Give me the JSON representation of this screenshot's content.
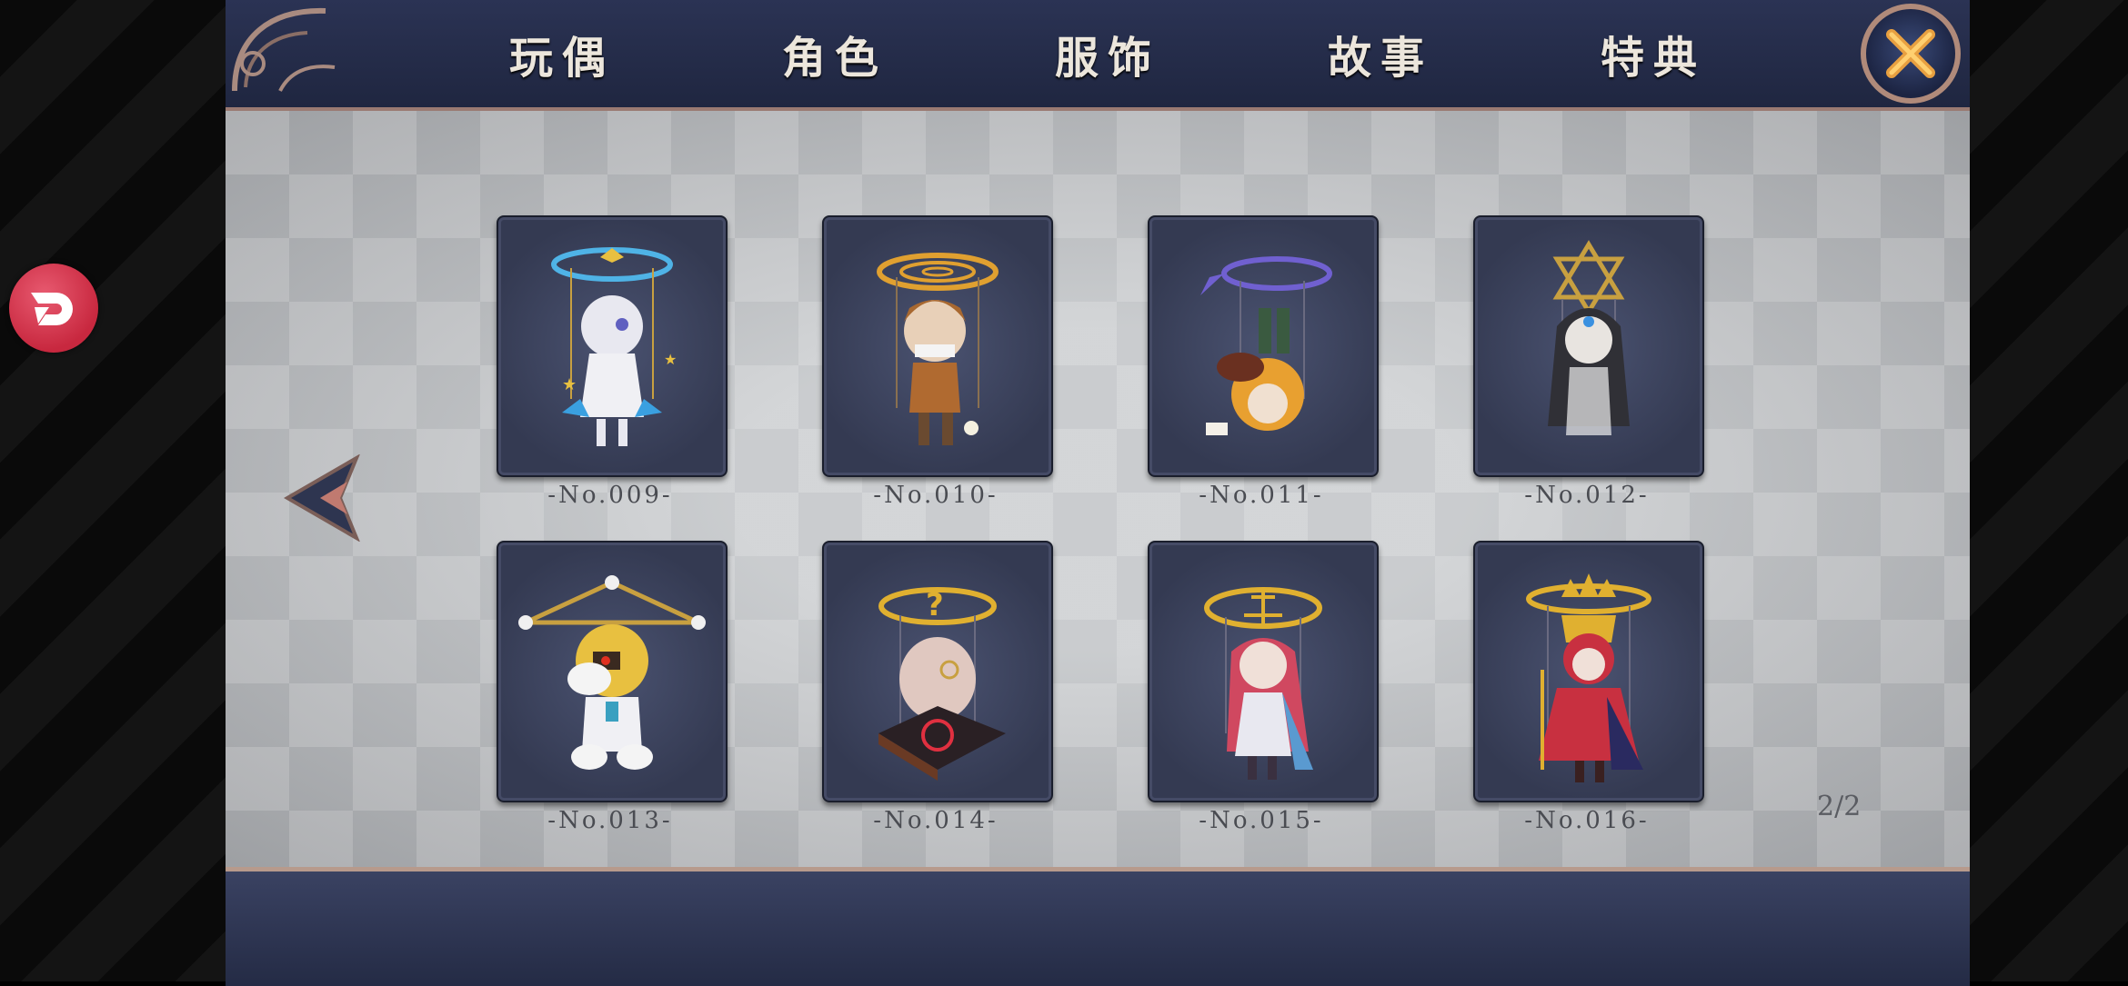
{
  "tabs": [
    {
      "label": "玩偶"
    },
    {
      "label": "角色"
    },
    {
      "label": "服饰"
    },
    {
      "label": "故事"
    },
    {
      "label": "特典"
    }
  ],
  "close_icon": "close-x-icon",
  "prev_icon": "chevron-left-icon",
  "float_icon": "overlay-logo-icon",
  "cards": [
    {
      "label": "-No.009-",
      "halo_color": "#4fb3e6",
      "figure_color": "#e8e8f0"
    },
    {
      "label": "-No.010-",
      "halo_color": "#e0a030",
      "figure_color": "#b06a30"
    },
    {
      "label": "-No.011-",
      "halo_color": "#7060d0",
      "figure_color": "#e8a030"
    },
    {
      "label": "-No.012-",
      "halo_color": "#c8a040",
      "figure_color": "#303036"
    },
    {
      "label": "-No.013-",
      "halo_color": "#c8a040",
      "figure_color": "#e8c040"
    },
    {
      "label": "-No.014-",
      "halo_color": "#e0b030",
      "figure_color": "#e0c8c0"
    },
    {
      "label": "-No.015-",
      "halo_color": "#e0b030",
      "figure_color": "#d04860"
    },
    {
      "label": "-No.016-",
      "halo_color": "#e0b030",
      "figure_color": "#c83040"
    }
  ],
  "pagination": "2/2",
  "colors": {
    "topbar": "#2b3354",
    "accent_border": "#b08a7a",
    "card_bg": "#3a4058"
  }
}
